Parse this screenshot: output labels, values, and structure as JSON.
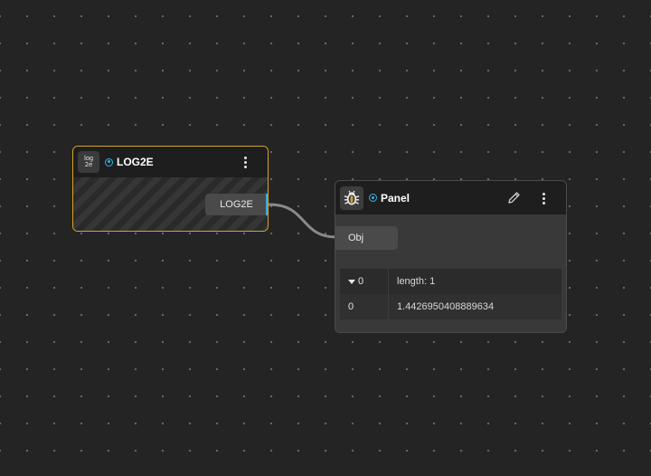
{
  "log2e_node": {
    "icon": "log2e-icon",
    "icon_text_top": "log",
    "icon_text_bottom": "2e",
    "title": "LOG2E",
    "output_label": "LOG2E",
    "border_color": "#d4a52a",
    "port_color": "#3aa7e0"
  },
  "panel_node": {
    "icon": "bug-icon",
    "title": "Panel",
    "input_label": "Obj",
    "table": {
      "header": {
        "key": "0",
        "value": "length: 1"
      },
      "rows": [
        {
          "key": "0",
          "value": "1.4426950408889634"
        }
      ]
    },
    "port_color": "#d4a52a"
  },
  "icons": {
    "status": "status-dot-icon",
    "menu": "kebab-menu-icon",
    "edit": "pencil-icon",
    "expand": "caret-down-icon"
  },
  "colors": {
    "background": "#242424",
    "accent_blue": "#32b4e6",
    "accent_gold": "#d4a52a"
  }
}
